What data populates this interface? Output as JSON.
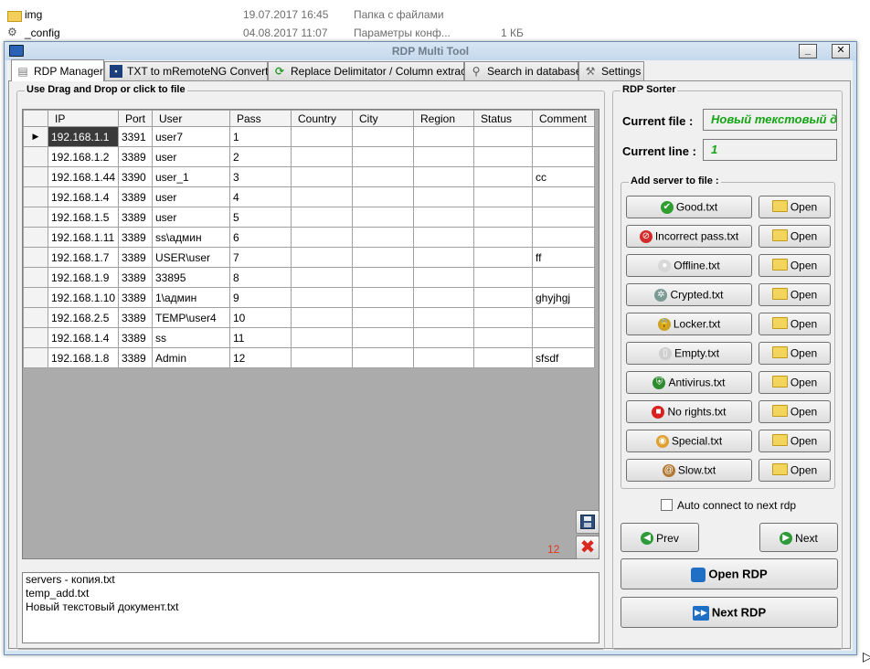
{
  "explorer": {
    "rows": [
      {
        "name": "img",
        "date": "19.07.2017 16:45",
        "type": "Папка с файлами",
        "size": ""
      },
      {
        "name": "_config",
        "date": "04.08.2017 11:07",
        "type": "Параметры конф...",
        "size": "1 КБ"
      }
    ]
  },
  "window": {
    "title": "RDP Multi Tool",
    "minimize": "_",
    "close": "✕"
  },
  "tabs": [
    {
      "label": "RDP Manager",
      "icon": "database-icon"
    },
    {
      "label": "TXT to mRemoteNG Converter",
      "icon": "converter-icon"
    },
    {
      "label": "Replace Delimitator / Column extractor",
      "icon": "refresh-icon"
    },
    {
      "label": "Search in database",
      "icon": "search-icon"
    },
    {
      "label": "Settings",
      "icon": "tools-icon"
    }
  ],
  "left_group": {
    "title": "Use Drag and Drop or click to file",
    "columns": [
      "IP",
      "Port",
      "User",
      "Pass",
      "Country",
      "City",
      "Region",
      "Status",
      "Comment"
    ],
    "rows": [
      [
        "192.168.1.1",
        "3391",
        "user7",
        "1",
        "",
        "",
        "",
        "",
        ""
      ],
      [
        "192.168.1.2",
        "3389",
        "user",
        "2",
        "",
        "",
        "",
        "",
        ""
      ],
      [
        "192.168.1.44",
        "3390",
        "user_1",
        "3",
        "",
        "",
        "",
        "",
        "cc"
      ],
      [
        "192.168.1.4",
        "3389",
        "user",
        "4",
        "",
        "",
        "",
        "",
        ""
      ],
      [
        "192.168.1.5",
        "3389",
        "user",
        "5",
        "",
        "",
        "",
        "",
        ""
      ],
      [
        "192.168.1.11",
        "3389",
        "ss\\админ",
        "6",
        "",
        "",
        "",
        "",
        ""
      ],
      [
        "192.168.1.7",
        "3389",
        "USER\\user",
        "7",
        "",
        "",
        "",
        "",
        "ff"
      ],
      [
        "192.168.1.9",
        "3389",
        "33895",
        "8",
        "",
        "",
        "",
        "",
        ""
      ],
      [
        "192.168.1.10",
        "3389",
        "1\\админ",
        "9",
        "",
        "",
        "",
        "",
        "ghyjhgj"
      ],
      [
        "192.168.2.5",
        "3389",
        "TEMP\\user4",
        "10",
        "",
        "",
        "",
        "",
        ""
      ],
      [
        "192.168.1.4",
        "3389",
        "ss",
        "11",
        "",
        "",
        "",
        "",
        ""
      ],
      [
        "192.168.1.8",
        "3389",
        "Admin",
        "12",
        "",
        "",
        "",
        "",
        "sfsdf"
      ]
    ],
    "row_count": "12",
    "current_row_marker": "▶",
    "files": [
      "servers - копия.txt",
      "temp_add.txt",
      "Новый текстовый документ.txt"
    ]
  },
  "sorter": {
    "title": "RDP Sorter",
    "current_file_label": "Current file :",
    "current_file_value": "Новый текстовый д",
    "current_line_label": "Current line :",
    "current_line_value": "1",
    "add_server_title": "Add server to file :",
    "open_label": "Open",
    "buttons": [
      {
        "label": "Good.txt",
        "icon": "check-icon",
        "color": "#2f9e2f",
        "glyph": "✔"
      },
      {
        "label": "Incorrect pass.txt",
        "icon": "no-entry-icon",
        "color": "#d32b2b",
        "glyph": "⊘"
      },
      {
        "label": "Offline.txt",
        "icon": "offline-icon",
        "color": "#d8d8d8",
        "glyph": "●"
      },
      {
        "label": "Crypted.txt",
        "icon": "gear-icon",
        "color": "#7a9a94",
        "glyph": "✲"
      },
      {
        "label": "Locker.txt",
        "icon": "lock-icon",
        "color": "#c9a227",
        "glyph": "🔒"
      },
      {
        "label": "Empty.txt",
        "icon": "empty-file-icon",
        "color": "#cfcfcf",
        "glyph": "▯"
      },
      {
        "label": "Antivirus.txt",
        "icon": "shield-icon",
        "color": "#2e8b2e",
        "glyph": "⛨"
      },
      {
        "label": "No rights.txt",
        "icon": "stop-sign-icon",
        "color": "#d92020",
        "glyph": "■"
      },
      {
        "label": "Special.txt",
        "icon": "special-icon",
        "color": "#e0a030",
        "glyph": "◉"
      },
      {
        "label": "Slow.txt",
        "icon": "snail-icon",
        "color": "#b07830",
        "glyph": "@"
      }
    ],
    "auto_connect_label": "Auto connect to next rdp",
    "prev_label": "Prev",
    "next_label": "Next",
    "open_rdp_label": "Open RDP",
    "next_rdp_label": "Next RDP"
  }
}
